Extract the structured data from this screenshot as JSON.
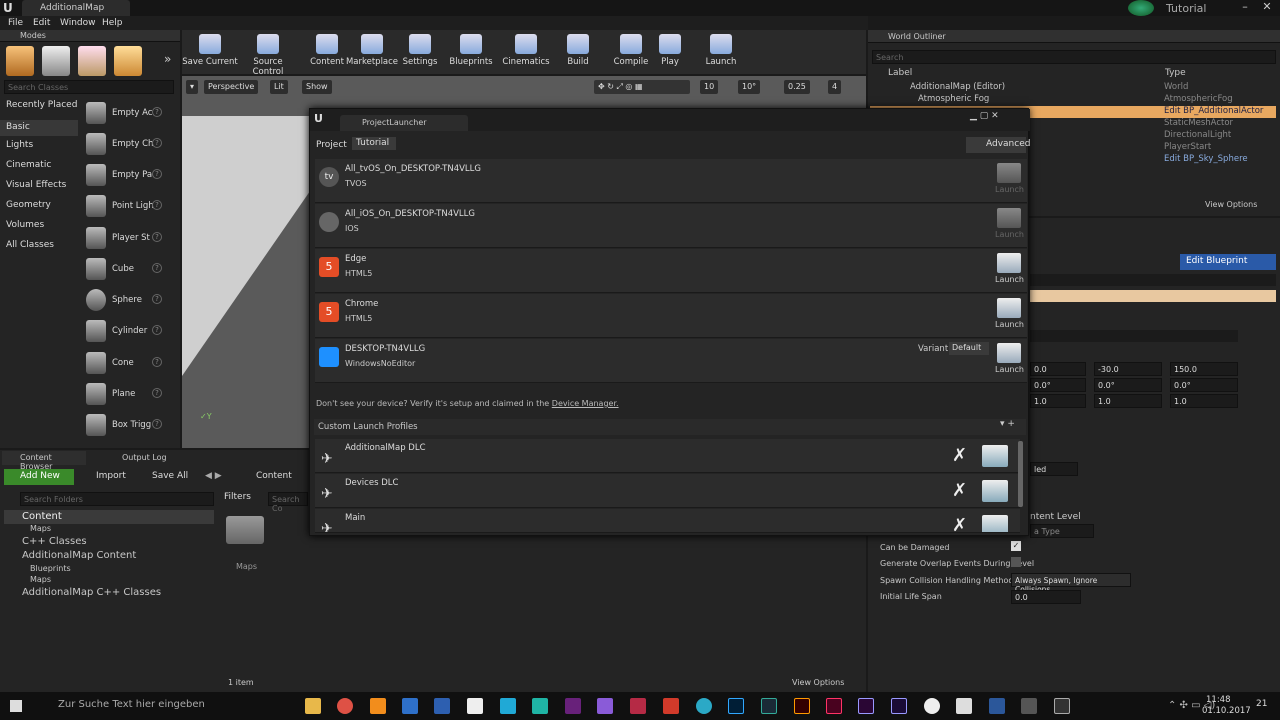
{
  "titlebar": {
    "doc_tab": "AdditionalMap",
    "right_label": "Tutorial"
  },
  "menu": [
    "File",
    "Edit",
    "Window",
    "Help"
  ],
  "modes": {
    "title": "Modes",
    "search_placeholder": "Search Classes",
    "categories": [
      "Recently Placed",
      "Basic",
      "Lights",
      "Cinematic",
      "Visual Effects",
      "Geometry",
      "Volumes",
      "All Classes"
    ],
    "items": [
      "Empty Ac",
      "Empty Ch",
      "Empty Pa",
      "Point Ligh",
      "Player St",
      "Cube",
      "Sphere",
      "Cylinder",
      "Cone",
      "Plane",
      "Box Trigg"
    ]
  },
  "toolbar": [
    "Save Current",
    "Source Control",
    "Content",
    "Marketplace",
    "Settings",
    "Blueprints",
    "Cinematics",
    "Build",
    "Compile",
    "Play",
    "Launch"
  ],
  "viewport": {
    "perspective": "Perspective",
    "lit": "Lit",
    "show": "Show",
    "grid": "10",
    "angle": "10°",
    "scale": "0.25",
    "cam": "4"
  },
  "launcher": {
    "tab": "ProjectLauncher",
    "project_label": "Project",
    "project_value": "Tutorial",
    "advanced": "Advanced",
    "devices": [
      {
        "name": "All_tvOS_On_DESKTOP-TN4VLLG",
        "type": "TVOS",
        "icon": "tv-icon",
        "launch": "Launch",
        "enabled": false
      },
      {
        "name": "All_iOS_On_DESKTOP-TN4VLLG",
        "type": "IOS",
        "icon": "apple-icon",
        "launch": "Launch",
        "enabled": false
      },
      {
        "name": "Edge",
        "type": "HTML5",
        "icon": "html5-icon",
        "launch": "Launch",
        "enabled": true
      },
      {
        "name": "Chrome",
        "type": "HTML5",
        "icon": "html5-icon",
        "launch": "Launch",
        "enabled": true
      },
      {
        "name": "DESKTOP-TN4VLLG",
        "type": "WindowsNoEditor",
        "icon": "windows-icon",
        "launch": "Launch",
        "enabled": true
      }
    ],
    "variant_label": "Variant",
    "variant_value": "Default",
    "hint": "Don't see your device? Verify it's setup and claimed in the",
    "hint_link": "Device Manager.",
    "custom_header": "Custom Launch Profiles",
    "profiles": [
      "AdditionalMap DLC",
      "Devices DLC",
      "Main"
    ]
  },
  "outliner": {
    "title": "World Outliner",
    "search_placeholder": "Search",
    "col_label": "Label",
    "col_type": "Type",
    "rows": [
      {
        "label": "AdditionalMap (Editor)",
        "type": "World"
      },
      {
        "label": "Atmospheric Fog",
        "type": "AtmosphericFog"
      },
      {
        "label": "",
        "type": "Edit BP_AdditionalActor"
      },
      {
        "label": "",
        "type": "StaticMeshActor"
      },
      {
        "label": "",
        "type": "DirectionalLight"
      },
      {
        "label": "",
        "type": "PlayerStart"
      },
      {
        "label": "",
        "type": "Edit BP_Sky_Sphere"
      }
    ],
    "view_options": "View Options"
  },
  "details": {
    "edit_blueprint": "Edit Blueprint",
    "loc": [
      "0.0",
      "-30.0",
      "150.0"
    ],
    "rot": [
      "0.0°",
      "0.0°",
      "0.0°"
    ],
    "scl": [
      "1.0",
      "1.0",
      "1.0"
    ],
    "props": [
      {
        "label": "Can be Damaged",
        "value": "✓"
      },
      {
        "label": "Generate Overlap Events During Level",
        "value": ""
      },
      {
        "label": "Spawn Collision Handling Method",
        "value": "Always Spawn, Ignore Collisions"
      },
      {
        "label": "Initial Life Span",
        "value": "0.0"
      }
    ],
    "partial": [
      "led",
      "ntent Level",
      "a Type"
    ]
  },
  "content_browser": {
    "tab1": "Content Browser",
    "tab2": "Output Log",
    "add_new": "Add New",
    "import": "Import",
    "save_all": "Save All",
    "path": "Content",
    "filters": "Filters",
    "search_folders": "Search Folders",
    "search_assets": "Search Co",
    "tree": [
      "Content",
      "Maps",
      "C++ Classes",
      "AdditionalMap Content",
      "Blueprints",
      "Maps",
      "AdditionalMap C++ Classes"
    ],
    "folder": "Maps",
    "count": "1 item",
    "view_options": "View Options"
  },
  "taskbar": {
    "search": "Zur Suche Text hier eingeben",
    "time": "11:48",
    "date": "01.10.2017",
    "badge": "21"
  }
}
